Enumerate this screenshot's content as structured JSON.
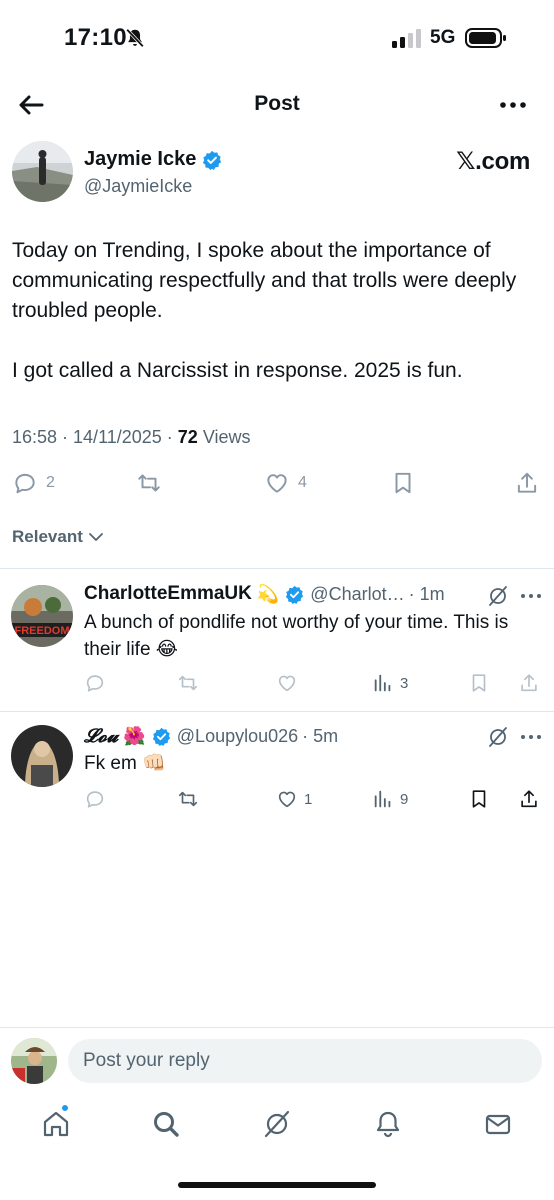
{
  "status_bar": {
    "time": "17:10",
    "network": "5G"
  },
  "nav": {
    "title": "Post"
  },
  "post": {
    "author_name": "Jaymie Icke",
    "author_handle": "@JaymieIcke",
    "watermark": "𝕏.com",
    "paragraph_1": "Today on Trending, I spoke about the importance of communicating respectfully and that trolls were deeply troubled people.",
    "paragraph_2": "I got called a Narcissist in response. 2025 is fun.",
    "timestamp": "16:58 · 14/11/2025 · ",
    "views_count": "72",
    "views_label": " Views",
    "replies": "2",
    "likes": "4"
  },
  "sort": {
    "label": "Relevant"
  },
  "replies": [
    {
      "name": "CharlotteEmmaUK",
      "name_emoji": "💫",
      "handle": "@Charlot…",
      "time": "· 1m",
      "text": "A bunch of pondlife not worthy of your time.  This is their life 😂",
      "views": "3"
    },
    {
      "name": "𝓛𝓸𝓾",
      "name_emoji": "🌺",
      "handle": "@Loupylou026",
      "time": "· 5m",
      "text": "Fk em 👊🏻",
      "likes": "1",
      "views": "9"
    }
  ],
  "composer": {
    "placeholder": "Post your reply"
  },
  "colors": {
    "accent": "#1d9bf0",
    "text": "#0f1419",
    "secondary": "#536471",
    "icon_gray": "#8b98a5"
  },
  "icons": [
    "back-arrow-icon",
    "more-icon",
    "verified-icon",
    "reply-icon",
    "repost-icon",
    "like-icon",
    "bookmark-icon",
    "share-icon",
    "views-icon",
    "grok-icon",
    "home-icon",
    "search-icon",
    "notifications-icon",
    "messages-icon"
  ]
}
